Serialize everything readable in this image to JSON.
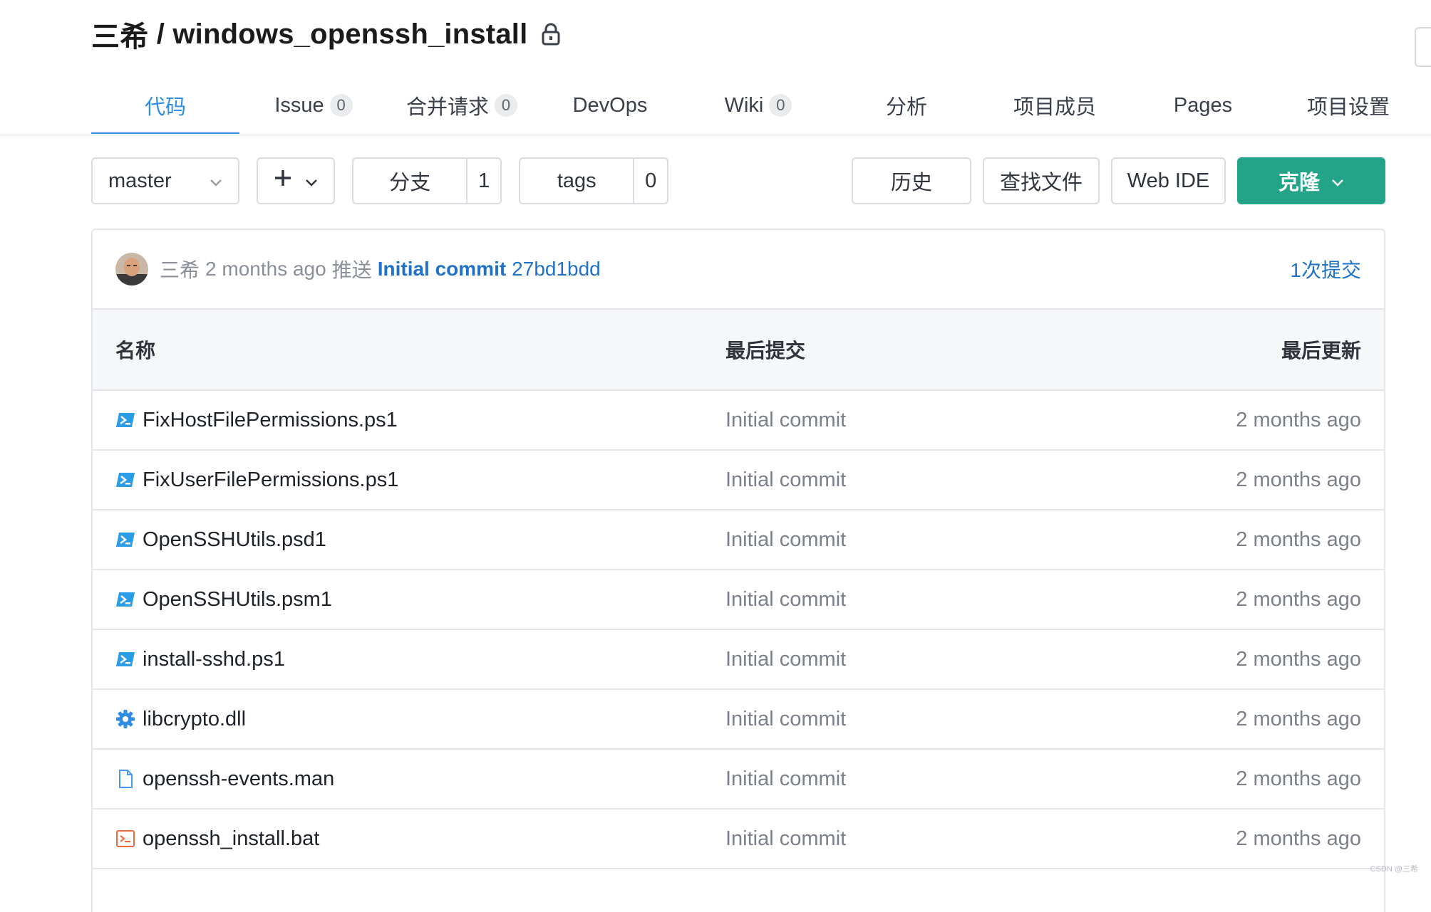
{
  "header": {
    "owner": "三希",
    "separator": " / ",
    "repo": "windows_openssh_install",
    "lock_icon": "lock-icon"
  },
  "nav": {
    "tabs": [
      {
        "label": "代码",
        "badge": null,
        "active": true
      },
      {
        "label": "Issue",
        "badge": "0"
      },
      {
        "label": "合并请求",
        "badge": "0"
      },
      {
        "label": "DevOps",
        "badge": null
      },
      {
        "label": "Wiki",
        "badge": "0"
      },
      {
        "label": "分析",
        "badge": null
      },
      {
        "label": "项目成员",
        "badge": null
      },
      {
        "label": "Pages",
        "badge": null
      },
      {
        "label": "项目设置",
        "badge": null
      }
    ]
  },
  "toolbar": {
    "branch": "master",
    "plus": "+",
    "branches_label": "分支",
    "branches_count": "1",
    "tags_label": "tags",
    "tags_count": "0",
    "history": "历史",
    "find_file": "查找文件",
    "web_ide": "Web IDE",
    "clone": "克隆"
  },
  "commit": {
    "author": "三希",
    "time": "2 months ago",
    "action": "推送",
    "message": "Initial commit",
    "sha": "27bd1bdd",
    "count": "1次提交"
  },
  "table": {
    "headers": {
      "name": "名称",
      "last_commit": "最后提交",
      "updated": "最后更新"
    },
    "rows": [
      {
        "name": "FixHostFilePermissions.ps1",
        "icon": "powershell-icon",
        "commit": "Initial commit",
        "updated": "2 months ago"
      },
      {
        "name": "FixUserFilePermissions.ps1",
        "icon": "powershell-icon",
        "commit": "Initial commit",
        "updated": "2 months ago"
      },
      {
        "name": "OpenSSHUtils.psd1",
        "icon": "powershell-icon",
        "commit": "Initial commit",
        "updated": "2 months ago"
      },
      {
        "name": "OpenSSHUtils.psm1",
        "icon": "powershell-icon",
        "commit": "Initial commit",
        "updated": "2 months ago"
      },
      {
        "name": "install-sshd.ps1",
        "icon": "powershell-icon",
        "commit": "Initial commit",
        "updated": "2 months ago"
      },
      {
        "name": "libcrypto.dll",
        "icon": "gear-icon",
        "commit": "Initial commit",
        "updated": "2 months ago"
      },
      {
        "name": "openssh-events.man",
        "icon": "file-icon",
        "commit": "Initial commit",
        "updated": "2 months ago"
      },
      {
        "name": "openssh_install.bat",
        "icon": "terminal-icon",
        "commit": "Initial commit",
        "updated": "2 months ago"
      }
    ]
  },
  "watermark": "CSDN @三希",
  "colors": {
    "accent": "#2f8ee3",
    "clone": "#23a387",
    "link": "#1f72c8"
  }
}
